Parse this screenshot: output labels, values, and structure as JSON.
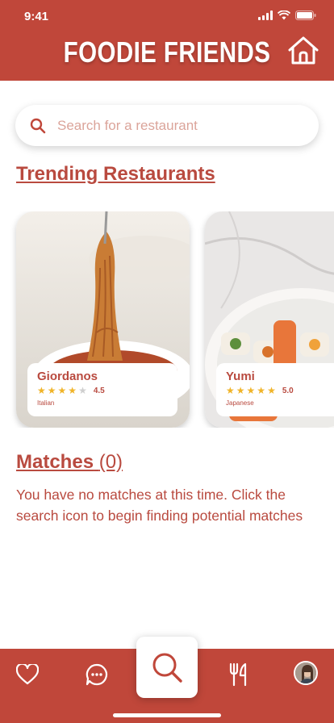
{
  "status_bar": {
    "time": "9:41"
  },
  "header": {
    "title": "FOODIE FRIENDS"
  },
  "search": {
    "placeholder": "Search for a restaurant"
  },
  "trending": {
    "title": "Trending Restaurants",
    "restaurants": [
      {
        "name": "Giordanos",
        "rating": "4.5",
        "stars": 4.5,
        "cuisine": "Italian"
      },
      {
        "name": "Yumi",
        "rating": "5.0",
        "stars": 5,
        "cuisine": "Japanese"
      }
    ]
  },
  "matches": {
    "title": "Matches",
    "count": "(0)",
    "empty_message": "You have no matches at this time. Click the search icon to begin finding potential matches"
  },
  "colors": {
    "brand": "#c0473a",
    "text": "#b94a3f",
    "star": "#f0b429"
  }
}
